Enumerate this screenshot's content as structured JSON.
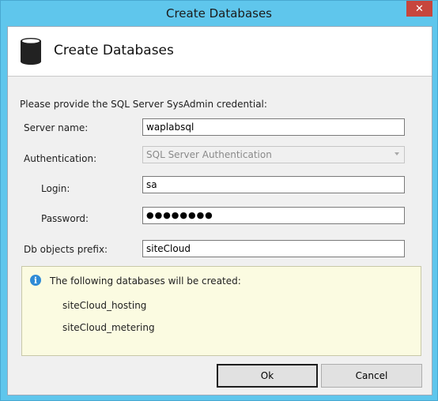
{
  "window": {
    "title": "Create Databases",
    "close_glyph": "✕"
  },
  "header": {
    "title": "Create Databases",
    "icon": "database-icon"
  },
  "form": {
    "intro": "Please provide the SQL Server SysAdmin credential:",
    "server_name_label": "Server name:",
    "server_name_value": "waplabsql",
    "authentication_label": "Authentication:",
    "authentication_value": "SQL Server Authentication",
    "login_label": "Login:",
    "login_value": "sa",
    "password_label": "Password:",
    "password_masked": "●●●●●●●●",
    "prefix_label": "Db objects prefix:",
    "prefix_value": "siteCloud"
  },
  "info": {
    "icon": "info-icon",
    "heading": "The following databases will be created:",
    "databases": [
      "siteCloud_hosting",
      "siteCloud_metering"
    ]
  },
  "buttons": {
    "ok_label": "Ok",
    "cancel_label": "Cancel"
  },
  "colors": {
    "title_bar": "#5fc6ec",
    "close_button": "#c7463d",
    "info_background": "#fbfbe1",
    "info_icon": "#2f8bd6"
  }
}
